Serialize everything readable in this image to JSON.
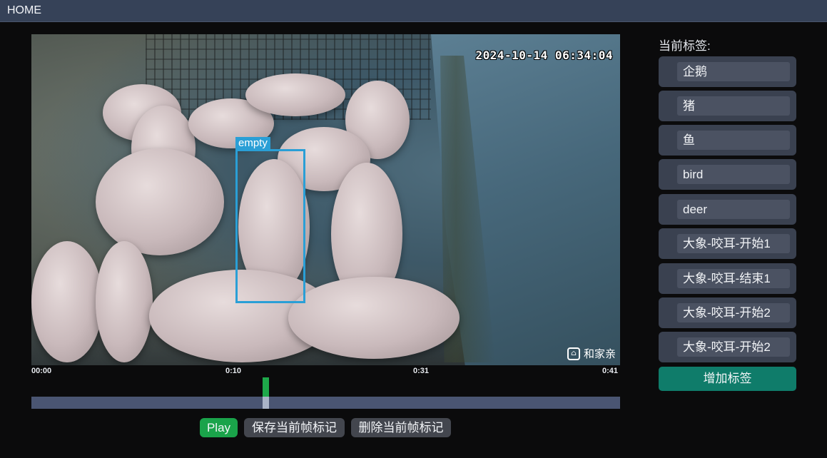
{
  "app": {
    "title": "HOME"
  },
  "video": {
    "timestamp": "2024-10-14 06:34:04",
    "watermark": "和家亲",
    "detection_label": "empty"
  },
  "timeline": {
    "ticks": [
      "00:00",
      "0:10",
      "0:31",
      "0:41"
    ]
  },
  "controls": {
    "play_label": "Play",
    "save_label": "保存当前帧标记",
    "delete_label": "删除当前帧标记"
  },
  "tags": {
    "title": "当前标签:",
    "items": [
      "企鹅",
      "猪",
      "鱼",
      "bird",
      "deer",
      "大象-咬耳-开始1",
      "大象-咬耳-结束1",
      "大象-咬耳-开始2",
      "大象-咬耳-开始2"
    ],
    "add_label": "增加标签"
  },
  "colors": {
    "topbar": "#364258",
    "bbox": "#2a9fd6",
    "play": "#1aa34a",
    "add": "#0f7c6a",
    "marker": "#1ea84a"
  }
}
